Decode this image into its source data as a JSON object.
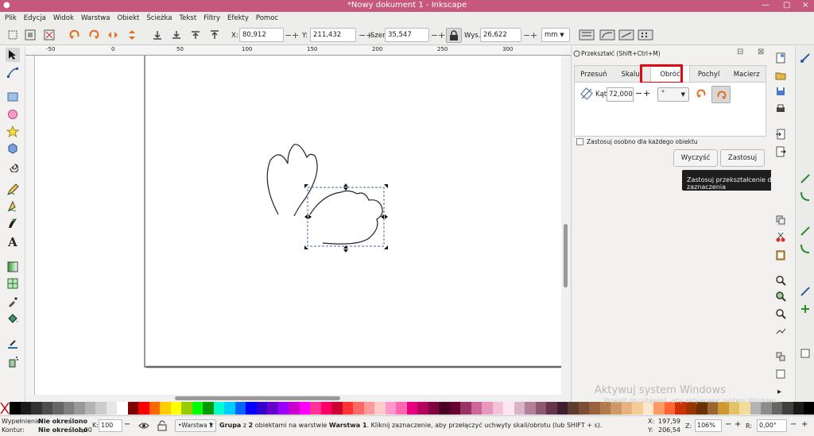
{
  "window": {
    "title": "*Nowy dokument 1 - Inkscape",
    "close": "×"
  },
  "menu": [
    "Plik",
    "Edycja",
    "Widok",
    "Warstwa",
    "Obiekt",
    "Ścieżka",
    "Tekst",
    "Filtry",
    "Efekty",
    "Pomoc"
  ],
  "toolbar": {
    "x_label": "X:",
    "x_value": "80,912",
    "y_label": "Y:",
    "y_value": "211,432",
    "w_label": "Szer.:",
    "w_value": "35,547",
    "h_label": "Wys.:",
    "h_value": "26,622",
    "unit": "mm",
    "plus": "+",
    "minus": "−"
  },
  "ruler": {
    "ticks": [
      "-50",
      "0",
      "50",
      "100",
      "150",
      "200",
      "250",
      "300"
    ]
  },
  "dock": {
    "title": "Przekształć (Shift+Ctrl+M)",
    "tabs": [
      "Przesuń",
      "Skaluj",
      "Obróć",
      "Pochyl",
      "Macierz"
    ],
    "angle_label": "Kąt:",
    "angle_value": "72,000",
    "angle_unit": "°",
    "separately_label": "Zastosuj osobno dla każdego obiektu",
    "clear_button": "Wyczyść",
    "apply_button": "Zastosuj",
    "tooltip": "Zastosuj przekształcenie do zaznaczenia"
  },
  "status": {
    "fill_label": "Wypełnienie:",
    "fill_value": "Nie określono",
    "stroke_label": "Kontur:",
    "stroke_value": "Nie określono",
    "stroke_width": "1,00",
    "opacity_label": "K:",
    "opacity_value": "100",
    "layer": "•Warstwa 1",
    "message_bold1": "Grupa",
    "message_mid1": " z ",
    "message_bold2": "2",
    "message_mid2": " obiektami na warstwie ",
    "message_bold3": "Warstwa 1",
    "message_end": ". Kliknij zaznaczenie, aby przełączyć uchwyty skali/obrotu (lub SHIFT + s).",
    "x_label": "X:",
    "x_value": "197,59",
    "y_label": "Y:",
    "y_value": "206,54",
    "zoom_label": "Z:",
    "zoom_value": "106%",
    "rot_label": "R:",
    "rot_value": "0,00°"
  },
  "watermark": {
    "line1": "Aktywuj system Windows",
    "line2": "Przejdź do ustawień, aby aktywować system Windows."
  },
  "palette": [
    "#000000",
    "#1a1a1a",
    "#333333",
    "#4d4d4d",
    "#666666",
    "#808080",
    "#999999",
    "#b3b3b3",
    "#cccccc",
    "#e6e6e6",
    "#ffffff",
    "#800000",
    "#ff0000",
    "#ff6600",
    "#ffcc00",
    "#ffff00",
    "#99cc00",
    "#00ff00",
    "#009900",
    "#00ffcc",
    "#00ccff",
    "#0066ff",
    "#0000ff",
    "#3300cc",
    "#6600cc",
    "#9900ff",
    "#cc00cc",
    "#ff00ff",
    "#ff3399",
    "#ff0066",
    "#cc0033",
    "#ff3333",
    "#ff6666",
    "#ff9999",
    "#ffcccc",
    "#ff99cc",
    "#ff66b2",
    "#e6007e",
    "#b3005c",
    "#800040",
    "#4d0026",
    "#660033",
    "#993366",
    "#cc6699",
    "#e699bb",
    "#f2c2d6",
    "#ffe6f0",
    "#d9b3c6",
    "#b38099",
    "#8c5973",
    "#66334d",
    "#3d1f2e",
    "#5c3d2e",
    "#7a4f35",
    "#99623d",
    "#b37a4d",
    "#cc9966",
    "#e6b380",
    "#f2cc99",
    "#ffe6cc",
    "#ff9966",
    "#ff6633",
    "#cc3300",
    "#993300",
    "#663300",
    "#996633",
    "#cc9933",
    "#e6c266",
    "#f2dc99",
    "#b3b3b3",
    "#8c8c8c",
    "#666666",
    "#404040",
    "#1a1a1a",
    "#000000"
  ]
}
